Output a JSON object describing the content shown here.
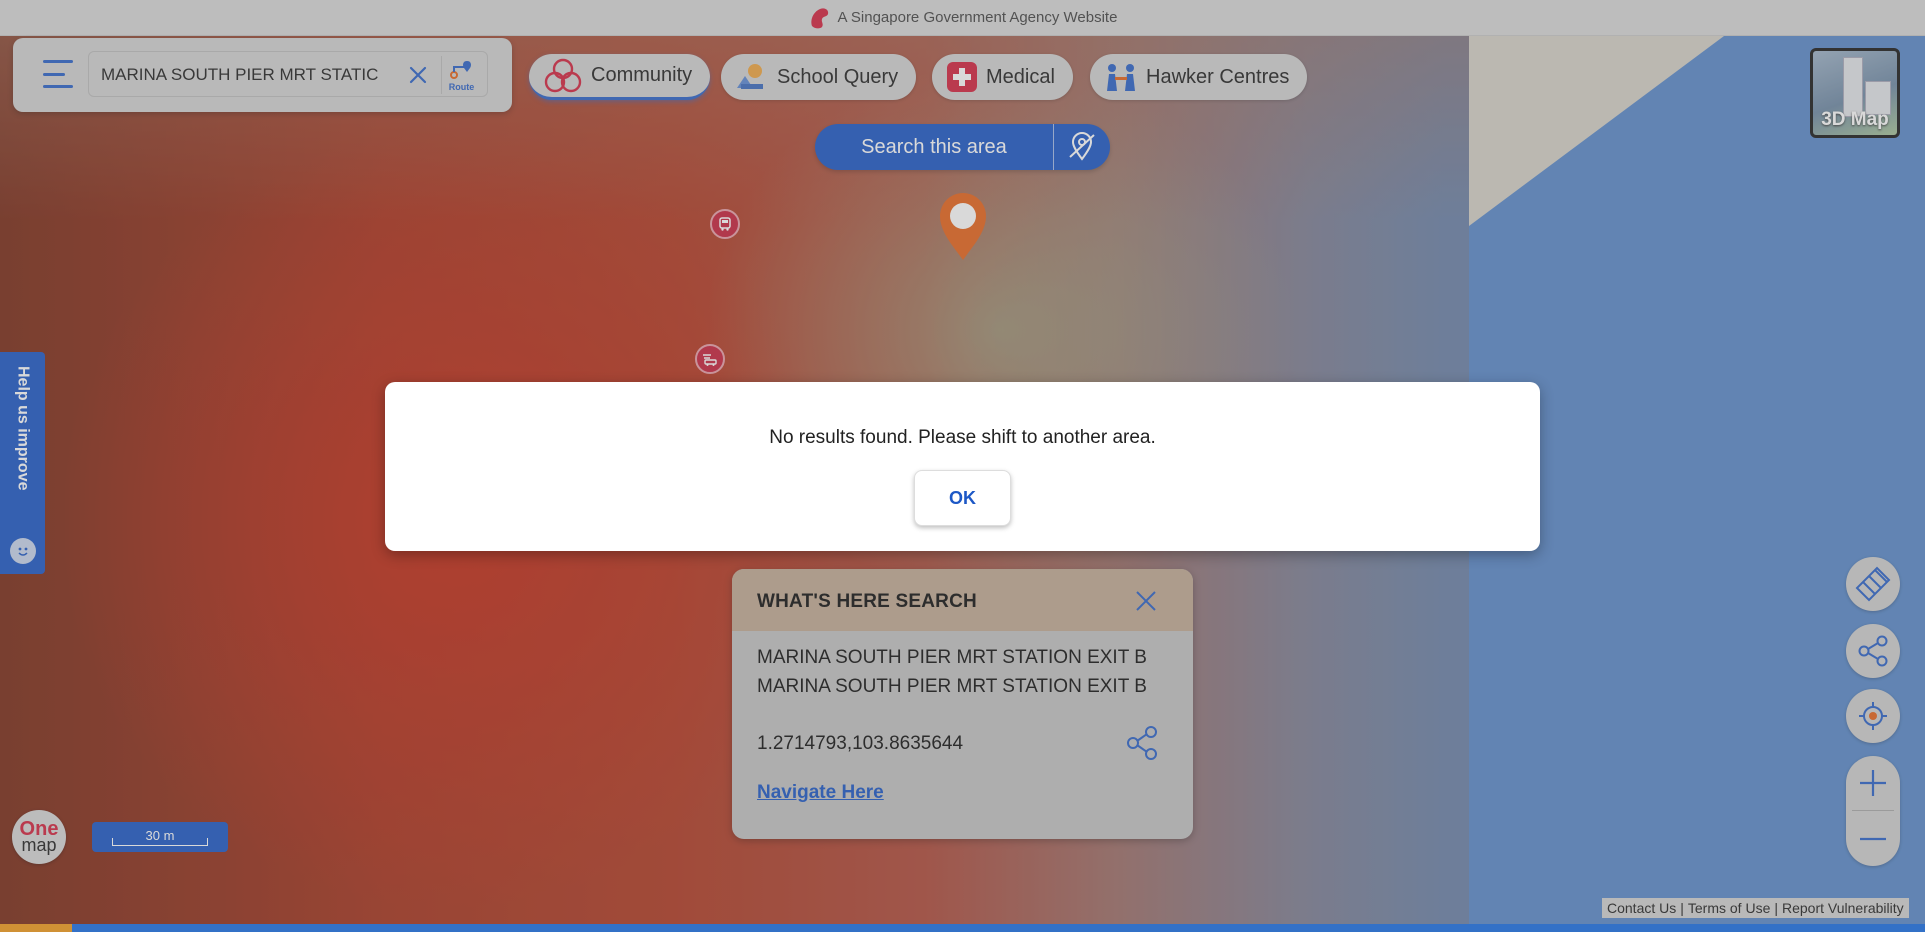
{
  "gov_bar": {
    "text": "A Singapore Government Agency Website"
  },
  "search": {
    "value": "MARINA SOUTH PIER MRT STATIC",
    "route_label": "Route"
  },
  "categories": [
    {
      "label": "Community",
      "icon": "community-icon",
      "active": true
    },
    {
      "label": "School Query",
      "icon": "school-icon",
      "active": false
    },
    {
      "label": "Medical",
      "icon": "medical-cross-icon",
      "active": false
    },
    {
      "label": "Hawker Centres",
      "icon": "hawker-icon",
      "active": false
    }
  ],
  "search_area": {
    "label": "Search this area"
  },
  "map3d": {
    "label": "3D Map"
  },
  "help_tab": {
    "label": "Help us improve"
  },
  "scale": {
    "label": "30 m"
  },
  "onemap_logo": {
    "line1": "One",
    "line2": "map"
  },
  "whats_here": {
    "title": "WHAT'S HERE SEARCH",
    "name": "MARINA SOUTH PIER MRT STATION EXIT B",
    "address": "MARINA SOUTH PIER MRT STATION EXIT B",
    "coordinates": "1.2714793,103.8635644",
    "navigate_label": "Navigate Here"
  },
  "dialog": {
    "message": "No results found. Please shift to another area.",
    "ok_label": "OK"
  },
  "footer": {
    "links": [
      "Contact Us",
      "Terms of Use",
      "Report Vulnerability"
    ],
    "separator": "|"
  },
  "colors": {
    "primary": "#1d58c6",
    "marker_red": "#c8223c",
    "pin_orange": "#e8641b",
    "sea": "#5a8acb"
  }
}
